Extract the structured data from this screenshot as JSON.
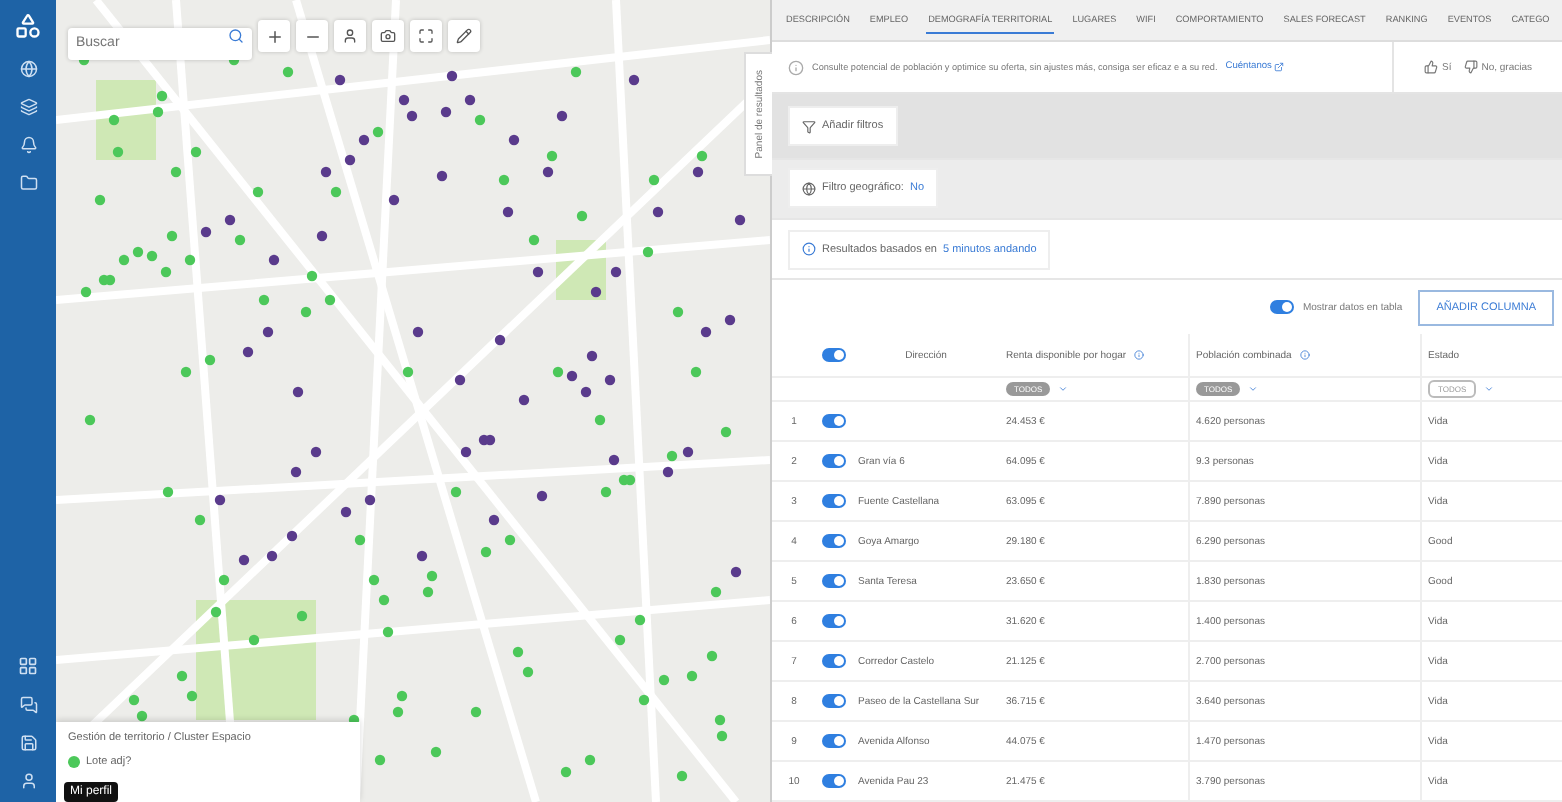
{
  "map": {
    "search": {
      "placeholder": "Buscar"
    },
    "legend": {
      "title": "Gestión de territorio / Cluster Espacio",
      "item": "Lote adj?"
    },
    "tooltip": "Mi perfil"
  },
  "panel": {
    "side_tab": "Panel de resultados",
    "tabs": [
      {
        "label": "DESCRIPCIÓN",
        "selected": false
      },
      {
        "label": "EMPLEO",
        "selected": false
      },
      {
        "label": "DEMOGRAFÍA TERRITORIAL",
        "selected": true
      },
      {
        "label": "LUGARES",
        "selected": false
      },
      {
        "label": "WIFI",
        "selected": false
      },
      {
        "label": "COMPORTAMIENTO",
        "selected": false
      },
      {
        "label": "SALES FORECAST",
        "selected": false
      },
      {
        "label": "RANKING",
        "selected": false
      },
      {
        "label": "EVENTOS",
        "selected": false
      },
      {
        "label": "CATEGO",
        "selected": false
      }
    ],
    "info": {
      "text": "Consulte potencial de población y optimice su oferta, sin ajustes más, consiga ser eficaz e a su red.",
      "link": "Cuéntanos"
    },
    "feedback": [
      {
        "label": "Sí"
      },
      {
        "label": "No, gracias"
      }
    ],
    "add_filters": "Añadir filtros",
    "geo_filter": {
      "label": "Filtro geográfico:",
      "value": "No"
    },
    "results": {
      "label": "Resultados basados en",
      "value": "5 minutos andando"
    },
    "show_table": {
      "label": "Mostrar datos en tabla",
      "on": true
    },
    "add_column": "AÑADIR COLUMNA"
  },
  "table": {
    "all_on": true,
    "columns": [
      "Dirección",
      "Renta disponible por hogar",
      "Población combinada",
      "Estado"
    ],
    "filters": [
      "TODOS",
      "TODOS",
      "TODOS"
    ],
    "rows": [
      {
        "n": "1",
        "on": true,
        "address": "",
        "income": "24.453 €",
        "population": "4.620 personas",
        "status": "Vida"
      },
      {
        "n": "2",
        "on": true,
        "address": "Gran vía 6",
        "income": "64.095 €",
        "population": "9.3 personas",
        "status": "Vida"
      },
      {
        "n": "3",
        "on": true,
        "address": "Fuente Castellana",
        "income": "63.095 €",
        "population": "7.890 personas",
        "status": "Vida"
      },
      {
        "n": "4",
        "on": true,
        "address": "Goya Amargo",
        "income": "29.180 €",
        "population": "6.290 personas",
        "status": "Good"
      },
      {
        "n": "5",
        "on": true,
        "address": "Santa Teresa",
        "income": "23.650 €",
        "population": "1.830 personas",
        "status": "Good"
      },
      {
        "n": "6",
        "on": true,
        "address": "",
        "income": "31.620 €",
        "population": "1.400 personas",
        "status": "Vida"
      },
      {
        "n": "7",
        "on": true,
        "address": "Corredor Castelo",
        "income": "21.125 €",
        "population": "2.700 personas",
        "status": "Vida"
      },
      {
        "n": "8",
        "on": true,
        "address": "Paseo de la Castellana Sur",
        "income": "36.715 €",
        "population": "3.640 personas",
        "status": "Vida"
      },
      {
        "n": "9",
        "on": true,
        "address": "Avenida Alfonso",
        "income": "44.075 €",
        "population": "1.470 personas",
        "status": "Vida"
      },
      {
        "n": "10",
        "on": true,
        "address": "Avenida Pau 23",
        "income": "21.475 €",
        "population": "3.790 personas",
        "status": "Vida"
      }
    ]
  }
}
